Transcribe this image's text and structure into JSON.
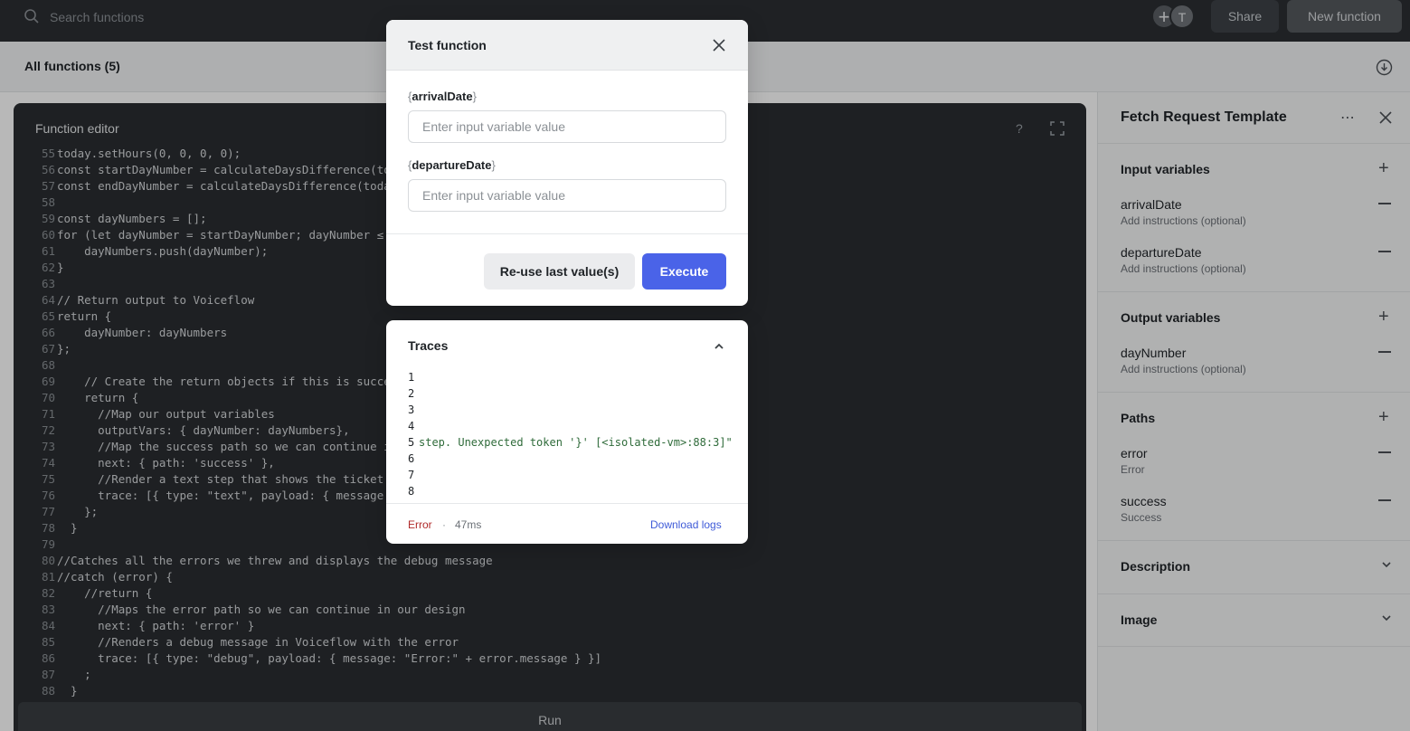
{
  "topbar": {
    "search_placeholder": "Search functions",
    "avatar_add": "+",
    "avatar_initial": "T",
    "share_label": "Share",
    "new_function_label": "New function"
  },
  "subbar": {
    "title": "All functions (5)"
  },
  "editor": {
    "title": "Function editor",
    "help": "?",
    "run_label": "Run",
    "lines": [
      {
        "n": "55",
        "code": "today.setHours(0, 0, 0, 0);"
      },
      {
        "n": "56",
        "code": "const startDayNumber = calculateDaysDifference(toda"
      },
      {
        "n": "57",
        "code": "const endDayNumber = calculateDaysDifference(today"
      },
      {
        "n": "58",
        "code": ""
      },
      {
        "n": "59",
        "code": "const dayNumbers = [];"
      },
      {
        "n": "60",
        "code": "for (let dayNumber = startDayNumber; dayNumber ≤ e"
      },
      {
        "n": "61",
        "code": "    dayNumbers.push(dayNumber);"
      },
      {
        "n": "62",
        "code": "}"
      },
      {
        "n": "63",
        "code": ""
      },
      {
        "n": "64",
        "code": "// Return output to Voiceflow"
      },
      {
        "n": "65",
        "code": "return {"
      },
      {
        "n": "66",
        "code": "    dayNumber: dayNumbers"
      },
      {
        "n": "67",
        "code": "};"
      },
      {
        "n": "68",
        "code": ""
      },
      {
        "n": "69",
        "code": "    // Create the return objects if this is succes"
      },
      {
        "n": "70",
        "code": "    return {"
      },
      {
        "n": "71",
        "code": "      //Map our output variables"
      },
      {
        "n": "72",
        "code": "      outputVars: { dayNumber: dayNumbers},"
      },
      {
        "n": "73",
        "code": "      //Map the success path so we can continue in"
      },
      {
        "n": "74",
        "code": "      next: { path: 'success' },"
      },
      {
        "n": "75",
        "code": "      //Render a text step that shows the ticket I"
      },
      {
        "n": "76",
        "code": "      trace: [{ type: \"text\", payload: { message: "
      },
      {
        "n": "77",
        "code": "    };"
      },
      {
        "n": "78",
        "code": "  }"
      },
      {
        "n": "79",
        "code": ""
      },
      {
        "n": "80",
        "code": "//Catches all the errors we threw and displays the debug message"
      },
      {
        "n": "81",
        "code": "//catch (error) {"
      },
      {
        "n": "82",
        "code": "    //return {"
      },
      {
        "n": "83",
        "code": "      //Maps the error path so we can continue in our design"
      },
      {
        "n": "84",
        "code": "      next: { path: 'error' }"
      },
      {
        "n": "85",
        "code": "      //Renders a debug message in Voiceflow with the error"
      },
      {
        "n": "86",
        "code": "      trace: [{ type: \"debug\", payload: { message: \"Error:\" + error.message } }]"
      },
      {
        "n": "87",
        "code": "    ;"
      },
      {
        "n": "88",
        "code": "  }"
      }
    ]
  },
  "panel": {
    "title": "Fetch Request Template",
    "more": "⋯",
    "input_variables": {
      "heading": "Input variables",
      "items": [
        {
          "name": "arrivalDate",
          "sub": "Add instructions (optional)"
        },
        {
          "name": "departureDate",
          "sub": "Add instructions (optional)"
        }
      ]
    },
    "output_variables": {
      "heading": "Output variables",
      "items": [
        {
          "name": "dayNumber",
          "sub": "Add instructions (optional)"
        }
      ]
    },
    "paths": {
      "heading": "Paths",
      "items": [
        {
          "name": "error",
          "sub": "Error"
        },
        {
          "name": "success",
          "sub": "Success"
        }
      ]
    },
    "description": {
      "heading": "Description"
    },
    "image": {
      "heading": "Image"
    }
  },
  "modal": {
    "title": "Test function",
    "var1_open": "{",
    "var1_name": "arrivalDate",
    "var1_close": "}",
    "var1_placeholder": "Enter input variable value",
    "var2_open": "{",
    "var2_name": "departureDate",
    "var2_close": "}",
    "var2_placeholder": "Enter input variable value",
    "reuse_label": "Re-use last value(s)",
    "execute_label": "Execute"
  },
  "traces": {
    "title": "Traces",
    "lines": [
      {
        "n": "1",
        "text": ""
      },
      {
        "n": "2",
        "text": ""
      },
      {
        "n": "3",
        "text": ""
      },
      {
        "n": "4",
        "text": ""
      },
      {
        "n": "5",
        "text": "step. Unexpected token '}' [<isolated-vm>:88:3]\""
      },
      {
        "n": "6",
        "text": ""
      },
      {
        "n": "7",
        "text": ""
      },
      {
        "n": "8",
        "text": ""
      }
    ],
    "status": "Error",
    "separator": "·",
    "duration": "47ms",
    "download_label": "Download logs"
  },
  "colors": {
    "accent": "#4a63e8",
    "error": "#b02a2a",
    "topbar_bg": "#2b2f33",
    "editor_bg": "#2a2d31"
  }
}
